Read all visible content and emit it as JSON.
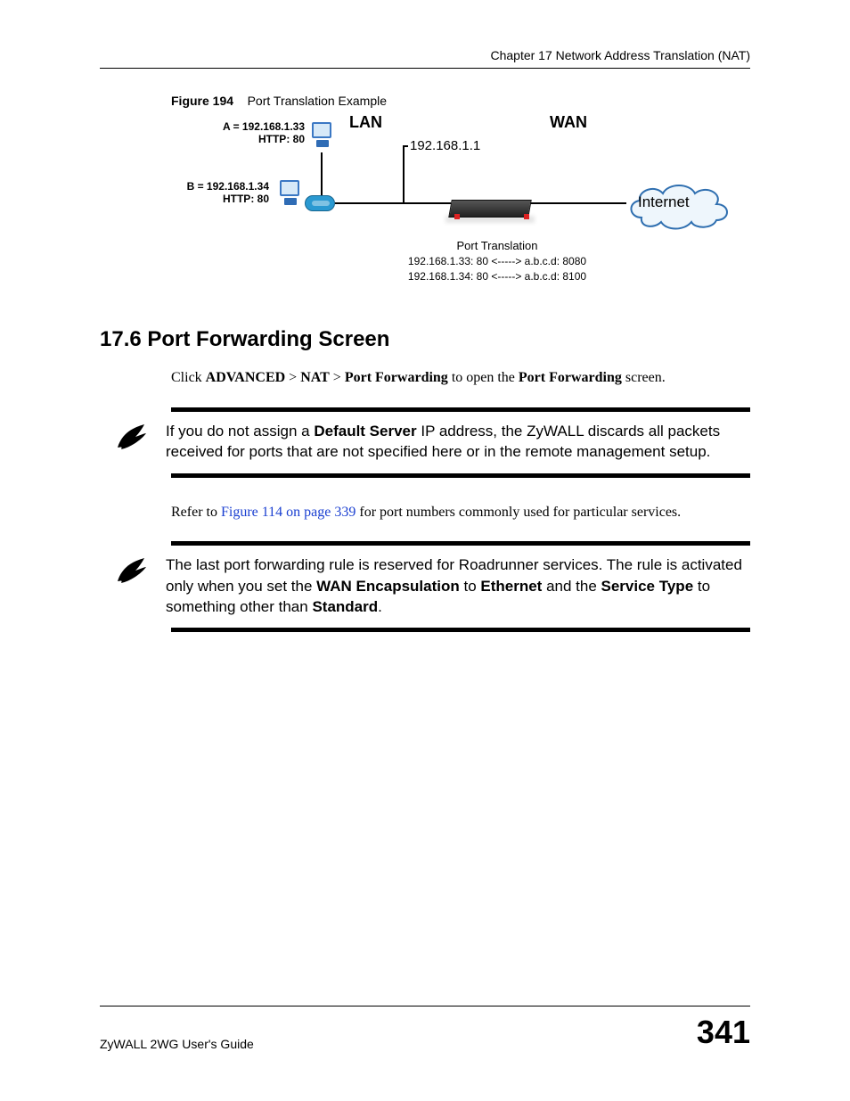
{
  "header": {
    "chapter_line": "Chapter 17 Network Address Translation (NAT)"
  },
  "figure": {
    "label": "Figure 194",
    "caption": "Port Translation Example",
    "lan_label": "LAN",
    "wan_label": "WAN",
    "gateway_ip": "192.168.1.1",
    "host_a_ip": "A = 192.168.1.33",
    "host_a_proto": "HTTP: 80",
    "host_b_ip": "B = 192.168.1.34",
    "host_b_proto": "HTTP: 80",
    "cloud_label": "Internet",
    "pt_title": "Port Translation",
    "pt_line1": "192.168.1.33: 80 <-----> a.b.c.d: 8080",
    "pt_line2": "192.168.1.34: 80 <-----> a.b.c.d: 8100"
  },
  "section": {
    "heading": "17.6  Port Forwarding Screen"
  },
  "para1": {
    "pre": "Click ",
    "b1": "ADVANCED",
    "sep1": " > ",
    "b2": "NAT",
    "sep2": " > ",
    "b3": "Port Forwarding",
    "mid": " to open the ",
    "b4": "Port Forwarding",
    "post": " screen."
  },
  "note1": {
    "pre": "If you do not assign a ",
    "b1": "Default Server",
    "post": " IP address, the ZyWALL discards all packets received for ports that are not specified here or in the remote management setup."
  },
  "para2": {
    "pre": "Refer to ",
    "link": "Figure 114 on page 339",
    "post": " for port numbers commonly used for particular services."
  },
  "note2": {
    "line1_pre": "The last port forwarding rule is reserved for Roadrunner services. The rule is activated only when you set the ",
    "b1": "WAN Encapsulation",
    "mid1": " to ",
    "b2": "Ethernet",
    "mid2": " and the ",
    "b3": "Service Type",
    "mid3": " to something other than ",
    "b4": "Standard",
    "post": "."
  },
  "footer": {
    "guide": "ZyWALL 2WG User's Guide",
    "page": "341"
  }
}
